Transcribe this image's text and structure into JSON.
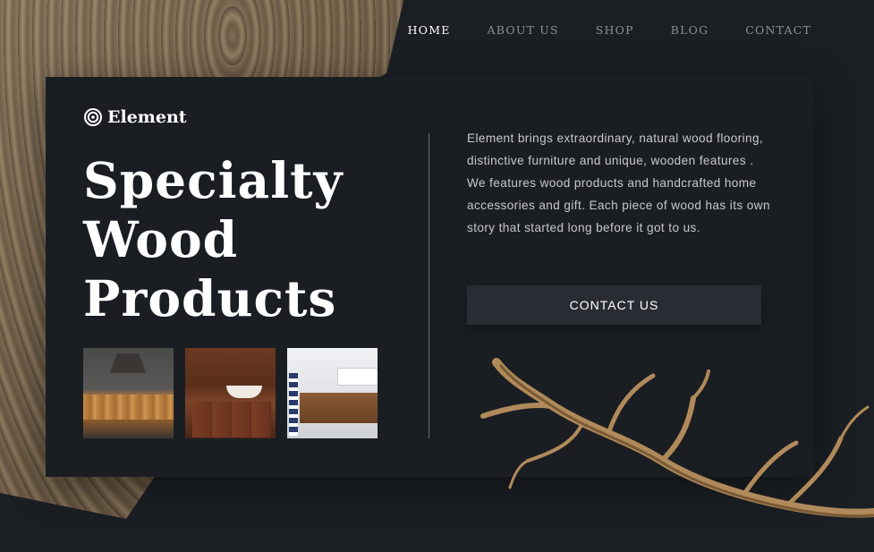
{
  "nav": {
    "items": [
      {
        "label": "HOME",
        "active": true
      },
      {
        "label": "ABOUT US",
        "active": false
      },
      {
        "label": "SHOP",
        "active": false
      },
      {
        "label": "BLOG",
        "active": false
      },
      {
        "label": "CONTACT",
        "active": false
      }
    ]
  },
  "brand": {
    "name": "Element",
    "icon": "spiral-logo-icon"
  },
  "hero": {
    "title_lines": [
      "Specialty",
      "Wood",
      "Products"
    ],
    "description": "Element brings extraordinary, natural wood flooring, distinctive furniture and unique, wooden features . We features wood products and handcrafted home accessories and gift. Each piece of wood has its own story that started long before it got to us.",
    "cta_label": "CONTACT US"
  },
  "thumbnails": [
    {
      "subject": "live-edge wood table with pendant lamp"
    },
    {
      "subject": "wooden bathroom vanity with vessel sink"
    },
    {
      "subject": "floating wood vanity with white sink"
    }
  ],
  "colors": {
    "background": "#1b1f24",
    "panel": "#1a1e23",
    "button": "#292d33",
    "nav_inactive": "#8c9096",
    "text_light": "#c7c9cc"
  }
}
